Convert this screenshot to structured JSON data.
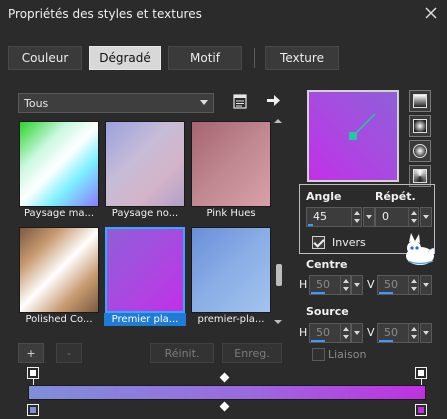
{
  "window": {
    "title": "Propriétés des styles et textures"
  },
  "tabs": [
    {
      "label": "Couleur",
      "active": false
    },
    {
      "label": "Dégradé",
      "active": true
    },
    {
      "label": "Motif",
      "active": false
    },
    {
      "label": "Texture",
      "active": false
    }
  ],
  "category_dropdown": {
    "value": "Tous"
  },
  "gradients": [
    {
      "label": "Paysage ma...",
      "colors": [
        "#7cf0ff",
        "#ffffff",
        "#2ad32a",
        "#8a7cff"
      ],
      "selected": false
    },
    {
      "label": "Paysage no...",
      "colors": [
        "#9aa2e0",
        "#d4b4c8",
        "#b0a0c8"
      ],
      "selected": false
    },
    {
      "label": "Pink Hues",
      "colors": [
        "#a66470",
        "#d8a0a8",
        "#c08890"
      ],
      "selected": false
    },
    {
      "label": "Polished Co...",
      "colors": [
        "#c89a70",
        "#ffffff",
        "#7a5a40"
      ],
      "selected": false
    },
    {
      "label": "Premier pla...",
      "colors": [
        "#8f5fd8",
        "#c230e8"
      ],
      "selected": true
    },
    {
      "label": "premier-pla...",
      "colors": [
        "#6a8fd8",
        "#a4c4ee"
      ],
      "selected": false
    }
  ],
  "buttons": {
    "add": "+",
    "remove": "-",
    "reset": "Réinit.",
    "save": "Enreg."
  },
  "angle": {
    "label": "Angle",
    "value": "45",
    "level": 0.125
  },
  "repeat": {
    "label": "Répét.",
    "value": "0"
  },
  "invert": {
    "label": "Invers",
    "checked": true
  },
  "center": {
    "label": "Centre",
    "h_label": "H",
    "h_value": "50",
    "v_label": "V",
    "v_value": "50",
    "level": 0.5
  },
  "source": {
    "label": "Source",
    "h_label": "H",
    "h_value": "50",
    "v_label": "V",
    "v_value": "50",
    "level": 0.5
  },
  "link": {
    "label": "Liaison",
    "checked": false
  },
  "colors": {
    "accent": "#1f7bd6",
    "gradient_start": "#7f8fd8",
    "gradient_end": "#c030e0"
  }
}
